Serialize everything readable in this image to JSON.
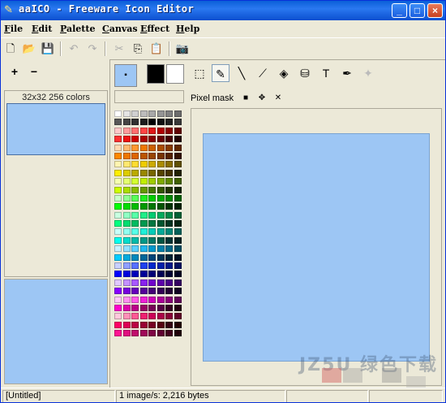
{
  "window": {
    "title": "aaICO - Freeware Icon Editor"
  },
  "title_buttons": {
    "minimize": "_",
    "maximize": "□",
    "close": "×"
  },
  "menu": [
    "File",
    "Edit",
    "Palette",
    "Canvas",
    "Effect",
    "Help"
  ],
  "toolbar": {
    "new": "🗋",
    "open": "📂",
    "save": "💾",
    "undo": "↶",
    "redo": "↷",
    "cut": "✂",
    "copy": "⎘",
    "paste": "📋",
    "capture": "📷"
  },
  "left_panel": {
    "add": "+",
    "remove": "−",
    "list_caption": "32x32 256 colors"
  },
  "palette": {
    "current_label": "▪",
    "rows": [
      [
        "#ffffff",
        "#e4e4e4",
        "#d0d0d0",
        "#bcbcbc",
        "#a8a8a8",
        "#949494",
        "#808080",
        "#6c6c6c"
      ],
      [
        "#585858",
        "#444444",
        "#303030",
        "#1c1c1c",
        "#000000",
        "#101010",
        "#202020",
        "#383838"
      ],
      [
        "#ffc8c8",
        "#ff9c9c",
        "#ff7070",
        "#ff4444",
        "#e01818",
        "#b00000",
        "#880000",
        "#600000"
      ],
      [
        "#ff3030",
        "#ee1010",
        "#cc0000",
        "#aa0000",
        "#880000",
        "#660000",
        "#440000",
        "#220000"
      ],
      [
        "#ffd8b0",
        "#ffb870",
        "#ff9830",
        "#ee7800",
        "#cc6000",
        "#aa4c00",
        "#883a00",
        "#602800"
      ],
      [
        "#ff8800",
        "#ee7700",
        "#dd6600",
        "#bb5500",
        "#994400",
        "#773300",
        "#552200",
        "#331100"
      ],
      [
        "#fff4b0",
        "#ffe870",
        "#ffdc30",
        "#eecc00",
        "#ccaa00",
        "#aa8c00",
        "#886e00",
        "#605000"
      ],
      [
        "#ffee00",
        "#ddcc00",
        "#bbaa00",
        "#998800",
        "#776600",
        "#554400",
        "#443300",
        "#222200"
      ],
      [
        "#f4ffb0",
        "#e4ff70",
        "#d4ff30",
        "#c0ee00",
        "#a0cc00",
        "#80aa00",
        "#608800",
        "#406000"
      ],
      [
        "#ccff00",
        "#aadd00",
        "#88bb00",
        "#669900",
        "#447700",
        "#335500",
        "#223300",
        "#112200"
      ],
      [
        "#c8ffc8",
        "#90ff90",
        "#58ff58",
        "#20ee20",
        "#00cc00",
        "#00aa00",
        "#008800",
        "#006000"
      ],
      [
        "#00ff00",
        "#00dd00",
        "#00bb00",
        "#009900",
        "#007700",
        "#005500",
        "#003300",
        "#002200"
      ],
      [
        "#c8ffe0",
        "#90ffc4",
        "#58ffa8",
        "#20ee88",
        "#00cc70",
        "#00aa5c",
        "#008848",
        "#006034"
      ],
      [
        "#00ff80",
        "#00dd70",
        "#00bb60",
        "#009950",
        "#007740",
        "#005530",
        "#003320",
        "#002210"
      ],
      [
        "#c8fff8",
        "#90fff0",
        "#58ffe8",
        "#20eed8",
        "#00ccb8",
        "#00aa98",
        "#008878",
        "#006058"
      ],
      [
        "#00ffee",
        "#00ddcc",
        "#00bbaa",
        "#009988",
        "#007766",
        "#005544",
        "#003333",
        "#002222"
      ],
      [
        "#c8f0ff",
        "#90e0ff",
        "#58d0ff",
        "#20b8ee",
        "#0098cc",
        "#0080aa",
        "#006888",
        "#004c60"
      ],
      [
        "#00ccff",
        "#00aadd",
        "#0088bb",
        "#006699",
        "#004477",
        "#003355",
        "#002233",
        "#001122"
      ],
      [
        "#c8d0ff",
        "#90a0ff",
        "#5870ff",
        "#2040ee",
        "#0028cc",
        "#0020aa",
        "#001888",
        "#001060"
      ],
      [
        "#0000ff",
        "#0000dd",
        "#0000bb",
        "#000099",
        "#000077",
        "#000055",
        "#000033",
        "#000022"
      ],
      [
        "#e0c8ff",
        "#c490ff",
        "#a858ff",
        "#8820ee",
        "#7000cc",
        "#5c00aa",
        "#480088",
        "#340060"
      ],
      [
        "#8800ff",
        "#7700dd",
        "#6600bb",
        "#550099",
        "#440077",
        "#330055",
        "#220033",
        "#110022"
      ],
      [
        "#ffc8f8",
        "#ff90f0",
        "#ff58e8",
        "#ee20d8",
        "#cc00b8",
        "#aa0098",
        "#880078",
        "#600058"
      ],
      [
        "#ff00cc",
        "#dd00aa",
        "#bb0088",
        "#990066",
        "#770055",
        "#550044",
        "#330022",
        "#220011"
      ],
      [
        "#ffc8dc",
        "#ff90b8",
        "#ff5894",
        "#ee2070",
        "#cc0058",
        "#aa0048",
        "#880038",
        "#600028"
      ],
      [
        "#ff0066",
        "#dd0055",
        "#bb0044",
        "#990033",
        "#770022",
        "#550011",
        "#330011",
        "#220000"
      ],
      [
        "#ff1493",
        "#e01080",
        "#c00c6c",
        "#a00858",
        "#800444",
        "#600030",
        "#40001c",
        "#200008"
      ]
    ]
  },
  "editor": {
    "tools": [
      "⬚",
      "✎",
      "╲",
      "⟋",
      "◈",
      "⛁",
      "T",
      "✒",
      "✦"
    ],
    "mask_label": "Pixel mask",
    "mask_buttons": [
      "■",
      "✥",
      "✕"
    ]
  },
  "status": {
    "file": "[Untitled]",
    "info": "1 image/s: 2,216 bytes",
    "empty1": "",
    "empty2": ""
  },
  "watermark": "JZ5U 绿色下载"
}
